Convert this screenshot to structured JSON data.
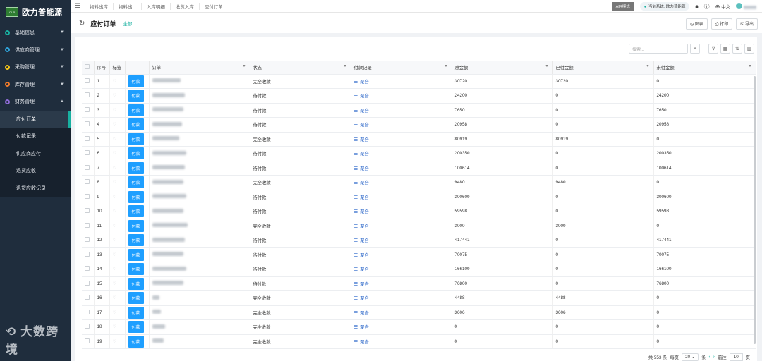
{
  "brand": {
    "logo_text": "欧力普能源",
    "logo_mark": "OLP"
  },
  "sidebar": {
    "items": [
      {
        "label": "基础信息",
        "color": "#18b0a0"
      },
      {
        "label": "供应商管理",
        "color": "#2fa0d6"
      },
      {
        "label": "采购管理",
        "color": "#f5c518"
      },
      {
        "label": "库存管理",
        "color": "#f07b2b"
      },
      {
        "label": "财务管理",
        "color": "#8e6bd6"
      }
    ],
    "subitems": [
      "应付订单",
      "付款记录",
      "供应商应付",
      "退货应收",
      "退货应收记录"
    ],
    "watermark": "大数跨境"
  },
  "topbar": {
    "breadcrumbs": [
      "物料出库",
      "物料出...",
      "入库明细",
      "收货入库",
      "应付订单"
    ],
    "air_mode": "AIR模式",
    "system": "当前系统: 欧力普能源",
    "language": "中文"
  },
  "header": {
    "title": "应付订单",
    "filter_tag": "全部",
    "buttons": [
      "图表",
      "打印",
      "导出"
    ]
  },
  "search": {
    "placeholder": "搜索..."
  },
  "table": {
    "columns": [
      "序号",
      "标签",
      "订单",
      "状态",
      "付款记录",
      "总金额",
      "已付金额",
      "未付金额"
    ],
    "pay_label": "付款",
    "merge_label": "聚合",
    "rows": [
      {
        "no": "1",
        "status": "完全收款",
        "total": "30720",
        "paid": "30720",
        "unpaid": "0",
        "w": 40
      },
      {
        "no": "2",
        "status": "待付款",
        "total": "24200",
        "paid": "0",
        "unpaid": "24200",
        "w": 46
      },
      {
        "no": "3",
        "status": "待付款",
        "total": "7650",
        "paid": "0",
        "unpaid": "7650",
        "w": 44
      },
      {
        "no": "4",
        "status": "待付款",
        "total": "20958",
        "paid": "0",
        "unpaid": "20958",
        "w": 42
      },
      {
        "no": "5",
        "status": "完全收款",
        "total": "80919",
        "paid": "80919",
        "unpaid": "0",
        "w": 38
      },
      {
        "no": "6",
        "status": "待付款",
        "total": "200350",
        "paid": "0",
        "unpaid": "200350",
        "w": 48
      },
      {
        "no": "7",
        "status": "待付款",
        "total": "100614",
        "paid": "0",
        "unpaid": "100614",
        "w": 46
      },
      {
        "no": "8",
        "status": "完全收款",
        "total": "9480",
        "paid": "9480",
        "unpaid": "0",
        "w": 44
      },
      {
        "no": "9",
        "status": "待付款",
        "total": "300600",
        "paid": "0",
        "unpaid": "300600",
        "w": 48
      },
      {
        "no": "10",
        "status": "待付款",
        "total": "59598",
        "paid": "0",
        "unpaid": "59598",
        "w": 44
      },
      {
        "no": "11",
        "status": "完全收款",
        "total": "3000",
        "paid": "3000",
        "unpaid": "0",
        "w": 50
      },
      {
        "no": "12",
        "status": "待付款",
        "total": "417441",
        "paid": "0",
        "unpaid": "417441",
        "w": 46
      },
      {
        "no": "13",
        "status": "待付款",
        "total": "70075",
        "paid": "0",
        "unpaid": "70075",
        "w": 44
      },
      {
        "no": "14",
        "status": "待付款",
        "total": "166100",
        "paid": "0",
        "unpaid": "166100",
        "w": 48
      },
      {
        "no": "15",
        "status": "待付款",
        "total": "76800",
        "paid": "0",
        "unpaid": "76800",
        "w": 44
      },
      {
        "no": "16",
        "status": "完全收款",
        "total": "4488",
        "paid": "4488",
        "unpaid": "0",
        "w": 10
      },
      {
        "no": "17",
        "status": "完全收款",
        "total": "3606",
        "paid": "3606",
        "unpaid": "0",
        "w": 12
      },
      {
        "no": "18",
        "status": "完全收款",
        "total": "0",
        "paid": "0",
        "unpaid": "0",
        "w": 18
      },
      {
        "no": "19",
        "status": "完全收款",
        "total": "0",
        "paid": "0",
        "unpaid": "0",
        "w": 16
      }
    ]
  },
  "pager": {
    "total_text": "共 553 条",
    "per_page_label": "每页",
    "per_page": "20",
    "unit": "条",
    "goto_label": "前往",
    "page": "10",
    "page_unit": "页"
  }
}
